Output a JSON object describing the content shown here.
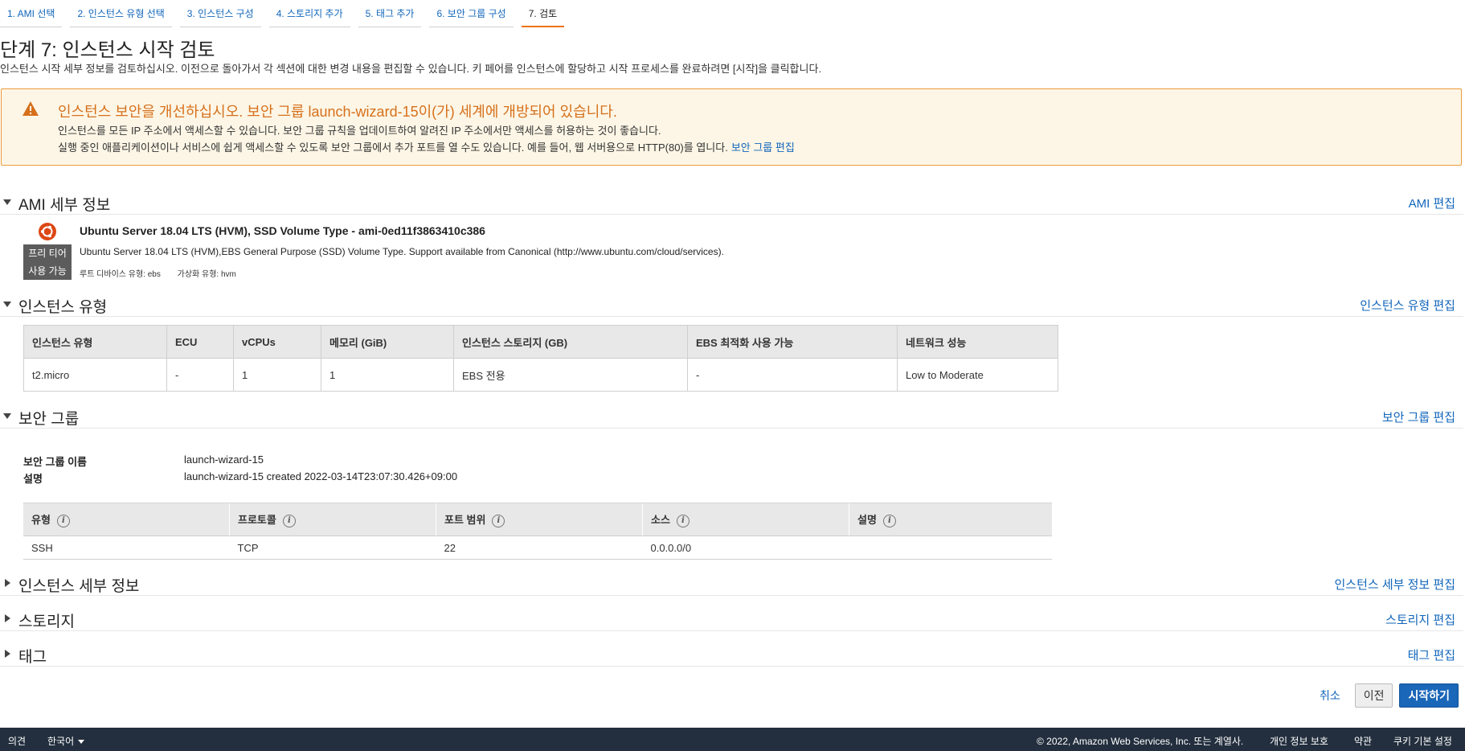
{
  "wizard": {
    "steps": [
      {
        "label": "1. AMI 선택"
      },
      {
        "label": "2. 인스턴스 유형 선택"
      },
      {
        "label": "3. 인스턴스 구성"
      },
      {
        "label": "4. 스토리지 추가"
      },
      {
        "label": "5. 태그 추가"
      },
      {
        "label": "6. 보안 그룹 구성"
      },
      {
        "label": "7. 검토"
      }
    ],
    "active_step": 6
  },
  "page": {
    "title": "단계 7: 인스턴스 시작 검토",
    "description": "인스턴스 시작 세부 정보를 검토하십시오. 이전으로 돌아가서 각 섹션에 대한 변경 내용을 편집할 수 있습니다. 키 페어를 인스턴스에 할당하고 시작 프로세스를 완료하려면 [시작]을 클릭합니다."
  },
  "warning": {
    "title": "인스턴스 보안을 개선하십시오. 보안 그룹 launch-wizard-15이(가) 세계에 개방되어 있습니다.",
    "line1": "인스턴스를 모든 IP 주소에서 액세스할 수 있습니다. 보안 그룹 규칙을 업데이트하여 알려진 IP 주소에서만 액세스를 허용하는 것이 좋습니다.",
    "line2": "실행 중인 애플리케이션이나 서비스에 쉽게 액세스할 수 있도록 보안 그룹에서 추가 포트를 열 수도 있습니다. 예를 들어, 웹 서버용으로 HTTP(80)를 엽니다.",
    "link": "보안 그룹 편집",
    "color": "#d6701b"
  },
  "sections": {
    "ami": {
      "title": "AMI 세부 정보",
      "edit": "AMI 편집"
    },
    "instance_type": {
      "title": "인스턴스 유형",
      "edit": "인스턴스 유형 편집"
    },
    "security_group": {
      "title": "보안 그룹",
      "edit": "보안 그룹 편집"
    },
    "instance_details": {
      "title": "인스턴스 세부 정보",
      "edit": "인스턴스 세부 정보 편집"
    },
    "storage": {
      "title": "스토리지",
      "edit": "스토리지 편집"
    },
    "tags": {
      "title": "태그",
      "edit": "태그 편집"
    }
  },
  "ami": {
    "name": "Ubuntu Server 18.04 LTS (HVM), SSD Volume Type - ami-0ed11f3863410c386",
    "description": "Ubuntu Server 18.04 LTS (HVM),EBS General Purpose (SSD) Volume Type. Support available from Canonical (http://www.ubuntu.com/cloud/services).",
    "root_device": "루트 디바이스 유형: ebs",
    "virtualization": "가상화 유형: hvm",
    "badge_line1": "프리 티어",
    "badge_line2": "사용 가능",
    "logo_icon": "ubuntu-logo-icon"
  },
  "instance_table": {
    "headers": [
      "인스턴스 유형",
      "ECU",
      "vCPUs",
      "메모리 (GiB)",
      "인스턴스 스토리지 (GB)",
      "EBS 최적화 사용 가능",
      "네트워크 성능"
    ],
    "row": [
      "t2.micro",
      "-",
      "1",
      "1",
      "EBS 전용",
      "-",
      "Low to Moderate"
    ]
  },
  "security_group": {
    "name_label": "보안 그룹 이름",
    "name_value": "launch-wizard-15",
    "desc_label": "설명",
    "desc_value": "launch-wizard-15 created 2022-03-14T23:07:30.426+09:00",
    "rules_headers": [
      "유형",
      "프로토콜",
      "포트 범위",
      "소스",
      "설명"
    ],
    "rules": [
      [
        "SSH",
        "TCP",
        "22",
        "0.0.0.0/0",
        ""
      ]
    ]
  },
  "actions": {
    "cancel": "취소",
    "previous": "이전",
    "launch": "시작하기"
  },
  "footer": {
    "feedback": "의견",
    "language": "한국어",
    "copyright": "© 2022, Amazon Web Services, Inc. 또는 계열사.",
    "privacy": "개인 정보 보호",
    "terms": "약관",
    "cookies": "쿠키 기본 설정"
  },
  "colors": {
    "accent": "#ec7211",
    "link": "#1166bb",
    "primary_button": "#1a66b8",
    "footer_bg": "#232f3e"
  }
}
